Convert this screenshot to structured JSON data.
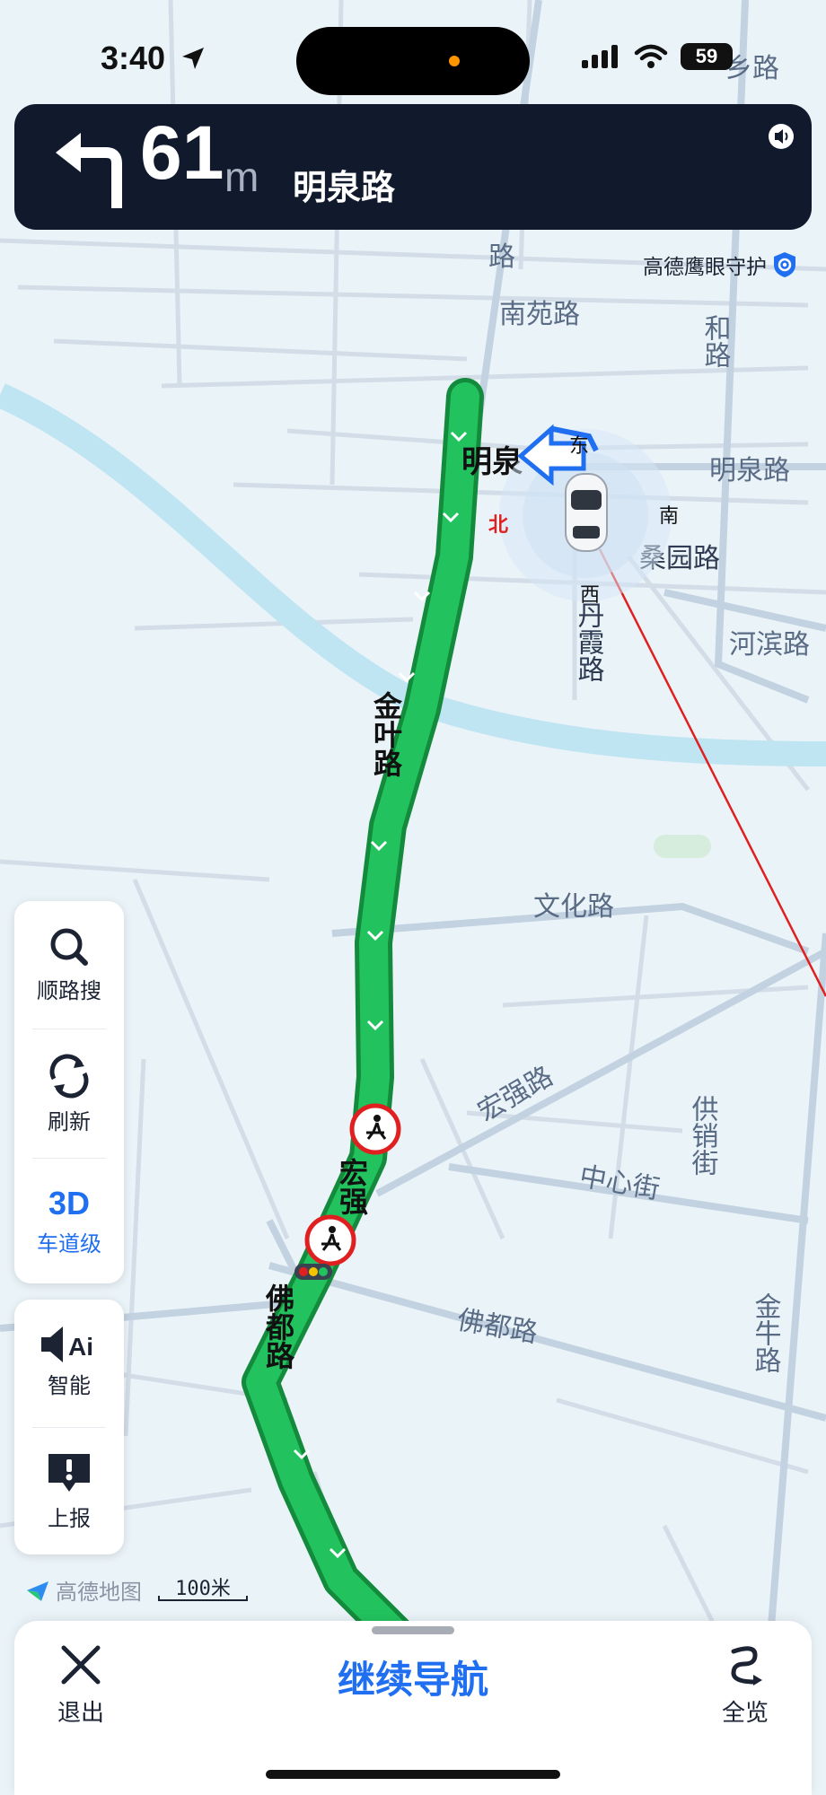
{
  "status_bar": {
    "time": "3:40",
    "battery": "59"
  },
  "navigation": {
    "distance_value": "61",
    "distance_unit": "m",
    "next_road": "明泉路"
  },
  "eye_guard_label": "高德鹰眼守护",
  "map_labels": {
    "road_1": "路",
    "nanyuan": "南苑路",
    "yihe": "和路",
    "mingquan_left": "明泉",
    "mingquan_right": "明泉路",
    "sangyuan": "桑园路",
    "danxia": "丹霞路",
    "hebin": "河滨路",
    "jinye": "金叶路",
    "wenhua": "文化路",
    "hongqiang": "宏强路",
    "hongqiang_route": "宏强",
    "gongxiao": "供销街",
    "zhongxin": "中心街",
    "fodu": "佛都路",
    "fodu_route": "佛都路",
    "jinniu": "金牛路",
    "xiang": "乡路",
    "compass_east": "东",
    "compass_south": "南",
    "compass_west": "西",
    "compass_north": "北"
  },
  "side_panel": {
    "search_label": "顺路搜",
    "refresh_label": "刷新",
    "lane_3d": "3D",
    "lane_label": "车道级",
    "smart_label": "智能",
    "report_label": "上报"
  },
  "map_logo": "高德地图",
  "scale_label": "100米",
  "bottom_bar": {
    "exit_label": "退出",
    "continue_label": "继续导航",
    "overview_label": "全览"
  },
  "colors": {
    "route": "#1db954",
    "banner": "#111a2c",
    "accent": "#1f6ff0",
    "river": "#bfe4f2"
  },
  "icons": [
    "location-arrow-icon",
    "signal-icon",
    "wifi-icon",
    "turn-left-icon",
    "sound-icon",
    "shield-icon",
    "search-icon",
    "refresh-icon",
    "speaker-ai-icon",
    "report-icon",
    "close-icon",
    "overview-icon",
    "pedestrian-warning-icon",
    "traffic-light-icon",
    "car-icon"
  ]
}
